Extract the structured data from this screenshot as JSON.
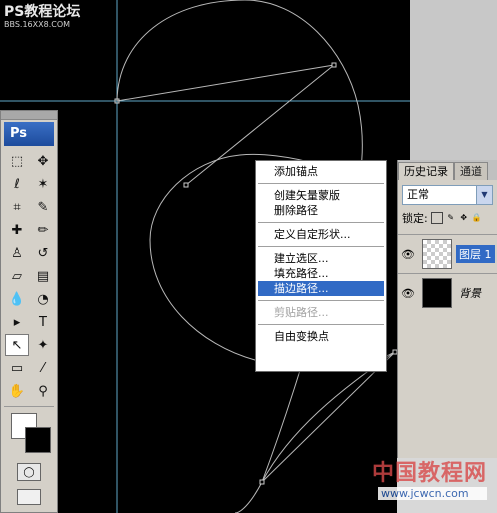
{
  "watermark": {
    "title": "PS教程论坛",
    "subtitle": "BBS.16XX8.COM"
  },
  "toolbox": {
    "logo": "Ps",
    "tools": [
      {
        "name": "marquee-tool",
        "glyph": "⬚"
      },
      {
        "name": "move-tool",
        "glyph": "✥"
      },
      {
        "name": "lasso-tool",
        "glyph": "ℓ"
      },
      {
        "name": "magic-wand-tool",
        "glyph": "✶"
      },
      {
        "name": "crop-tool",
        "glyph": "⌗"
      },
      {
        "name": "slice-tool",
        "glyph": "✎"
      },
      {
        "name": "healing-brush-tool",
        "glyph": "✚"
      },
      {
        "name": "brush-tool",
        "glyph": "✏"
      },
      {
        "name": "clone-stamp-tool",
        "glyph": "♙"
      },
      {
        "name": "history-brush-tool",
        "glyph": "↺"
      },
      {
        "name": "eraser-tool",
        "glyph": "▱"
      },
      {
        "name": "gradient-tool",
        "glyph": "▤"
      },
      {
        "name": "blur-tool",
        "glyph": "💧"
      },
      {
        "name": "dodge-tool",
        "glyph": "◔"
      },
      {
        "name": "path-selection-tool",
        "glyph": "▸"
      },
      {
        "name": "type-tool",
        "glyph": "T"
      },
      {
        "name": "direct-selection-tool",
        "glyph": "↖"
      },
      {
        "name": "shape-tool",
        "glyph": "✦"
      },
      {
        "name": "notes-tool",
        "glyph": "▭"
      },
      {
        "name": "eyedropper-tool",
        "glyph": "⁄"
      },
      {
        "name": "hand-tool",
        "glyph": "✋"
      },
      {
        "name": "zoom-tool",
        "glyph": "⚲"
      }
    ]
  },
  "context_menu": {
    "items": [
      {
        "label": "添加锚点",
        "state": "normal"
      },
      {
        "sep": true
      },
      {
        "label": "创建矢量蒙版",
        "state": "normal"
      },
      {
        "label": "删除路径",
        "state": "normal"
      },
      {
        "sep": true
      },
      {
        "label": "定义自定形状...",
        "state": "normal"
      },
      {
        "sep": true
      },
      {
        "label": "建立选区...",
        "state": "normal"
      },
      {
        "label": "填充路径...",
        "state": "normal"
      },
      {
        "label": "描边路径...",
        "state": "selected"
      },
      {
        "sep": true
      },
      {
        "label": "剪贴路径...",
        "state": "disabled"
      },
      {
        "sep": true
      },
      {
        "label": "自由变换点",
        "state": "normal"
      }
    ]
  },
  "layers_panel": {
    "tabs": [
      "历史记录",
      "通道"
    ],
    "blend_mode": "正常",
    "lock_label": "锁定:",
    "layers": [
      {
        "name": "图层 1",
        "thumb": "transparent",
        "selected": true
      },
      {
        "name": "背景",
        "thumb": "black",
        "selected": false
      }
    ]
  },
  "site_watermark": {
    "cn": "中国教程网",
    "url": "www.jcwcn.com"
  },
  "colors": {
    "menu_highlight": "#316ac5",
    "guide_line": "#5fa8c8",
    "path_stroke": "#b8b8b8"
  }
}
